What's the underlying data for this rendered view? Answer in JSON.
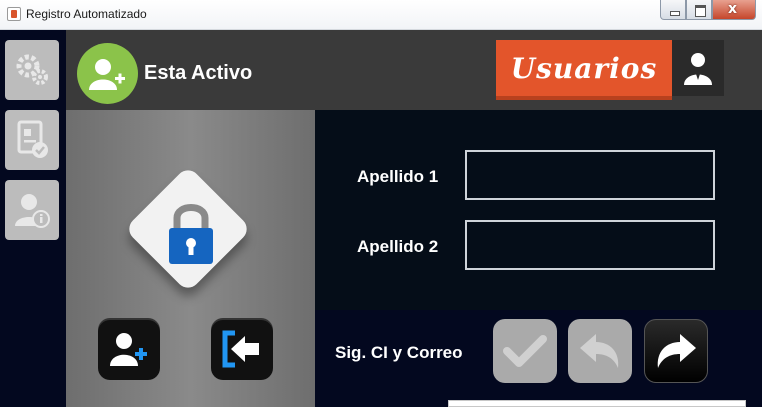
{
  "window": {
    "title": "Registro Automatizado",
    "controls": [
      "minimize",
      "maximize",
      "close"
    ],
    "close_glyph": "x"
  },
  "sidebar": {
    "items": [
      {
        "icon": "gears-icon",
        "state": "enabled"
      },
      {
        "icon": "document-check-icon",
        "state": "enabled"
      },
      {
        "icon": "user-info-icon",
        "state": "enabled"
      }
    ]
  },
  "header": {
    "status_icon": "add-user-icon",
    "status_text": "Esta Activo",
    "users_button_label": "Usuarios",
    "user_badge_icon": "user-suit-icon"
  },
  "left_panel": {
    "lock_icon": "padlock-icon",
    "actions": [
      {
        "icon": "add-user-icon"
      },
      {
        "icon": "logout-arrow-icon"
      }
    ]
  },
  "form": {
    "fields": [
      {
        "label": "Apellido 1",
        "value": "",
        "placeholder": ""
      },
      {
        "label": "Apellido 2",
        "value": "",
        "placeholder": ""
      }
    ]
  },
  "footer": {
    "sig_label": "Sig. CI y Correo",
    "buttons": [
      {
        "icon": "checkmark-icon",
        "state": "disabled"
      },
      {
        "icon": "undo-arrow-icon",
        "state": "disabled"
      },
      {
        "icon": "redo-arrow-icon",
        "state": "enabled"
      }
    ]
  },
  "colors": {
    "accent_orange": "#e3552b",
    "status_green": "#8bc34a",
    "header_bg": "#3a3a3a",
    "panel_dark": "#050d18",
    "rail_dark": "#03081f",
    "lock_blue": "#1565c0"
  }
}
